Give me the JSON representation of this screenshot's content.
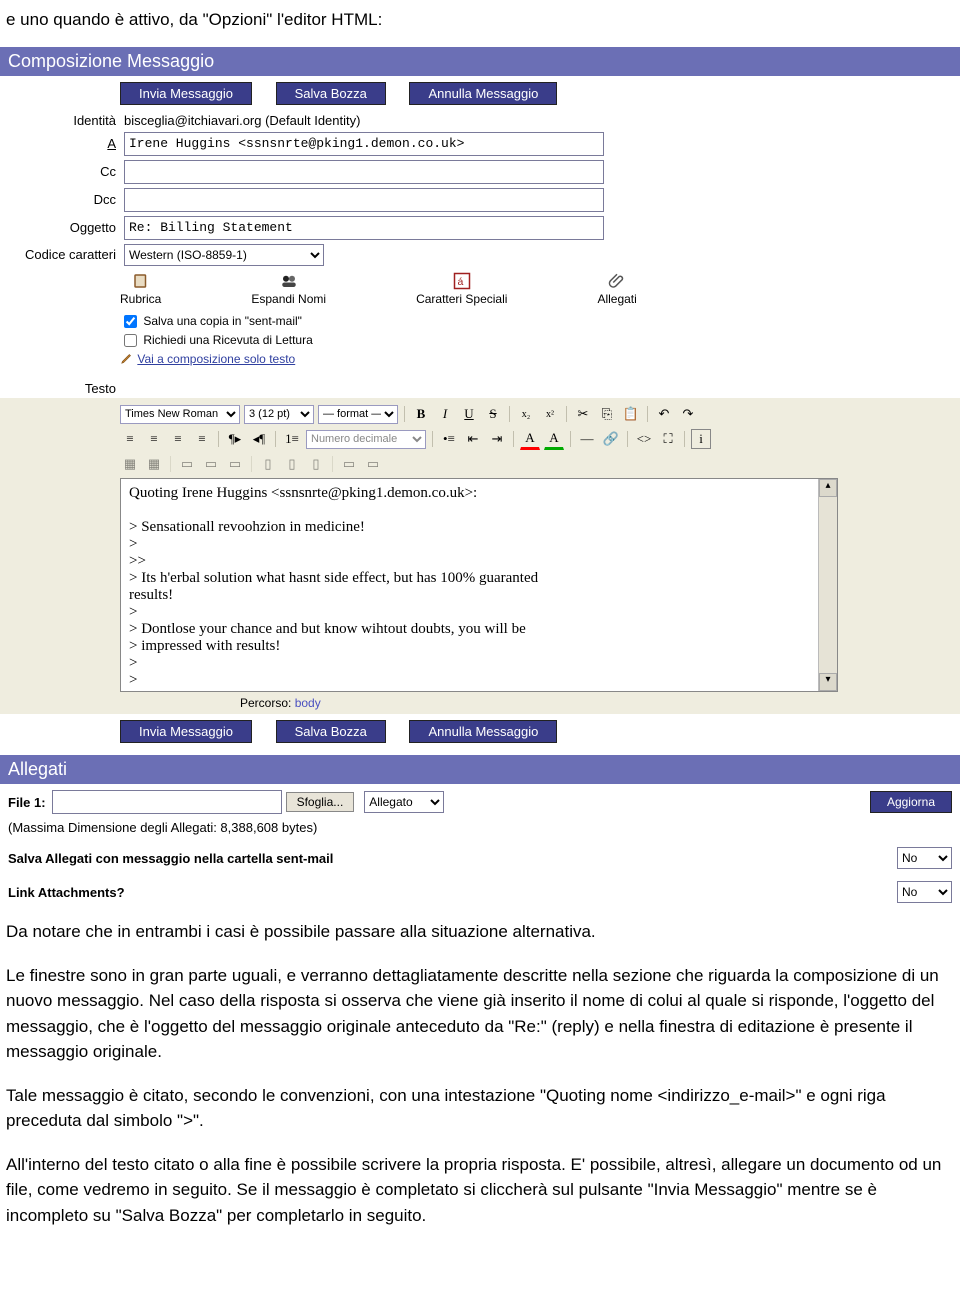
{
  "intro": "e uno quando è attivo, da \"Opzioni\" l'editor HTML:",
  "header_compose": "Composizione Messaggio",
  "buttons": {
    "send": "Invia Messaggio",
    "draft": "Salva Bozza",
    "cancel": "Annulla Messaggio"
  },
  "labels": {
    "identity": "Identità",
    "to": "A",
    "cc": "Cc",
    "bcc": "Dcc",
    "subject": "Oggetto",
    "charset": "Codice caratteri",
    "text": "Testo",
    "path": "Percorso:"
  },
  "fields": {
    "identity": "bisceglia@itchiavari.org (Default Identity)",
    "to": "Irene Huggins <ssnsnrte@pking1.demon.co.uk>",
    "cc": "",
    "bcc": "",
    "subject": "Re: Billing Statement",
    "charset": "Western (ISO-8859-1)"
  },
  "tools": {
    "rubrica": "Rubrica",
    "espandi": "Espandi Nomi",
    "caratteri": "Caratteri Speciali",
    "allegati": "Allegati"
  },
  "options": {
    "save_sent": "Salva una copia in \"sent-mail\"",
    "receipt": "Richiedi una Ricevuta di Lettura",
    "plain": "Vai a composizione solo testo"
  },
  "editor": {
    "font": "Times New Roman",
    "size": "3 (12 pt)",
    "format": "— format —",
    "listfmt": "Numero decimale",
    "body_lines": [
      "Quoting Irene Huggins <ssnsnrte@pking1.demon.co.uk>:",
      "",
      "> Sensationall revoohzion in medicine!",
      ">",
      ">>",
      "> Its h'erbal solution what hasnt side effect, but has 100% guaranted",
      "results!",
      ">",
      "> Dontlose your chance and but know wihtout doubts, you will be",
      "> impressed with results!",
      ">",
      ">"
    ],
    "path_value": "body"
  },
  "attachments": {
    "header": "Allegati",
    "file_label": "File 1:",
    "file_value": "",
    "browse": "Sfoglia...",
    "type": "Allegato",
    "maxsize": "(Massima Dimensione degli Allegati: 8,388,608 bytes)",
    "refresh": "Aggiorna",
    "save_with_msg": "Salva Allegati con messaggio nella cartella sent-mail",
    "link_att": "Link Attachments?",
    "no": "No"
  },
  "paragraphs": {
    "p1": "Da notare che in entrambi i casi è possibile passare alla situazione alternativa.",
    "p2": "Le finestre sono in gran parte uguali, e verranno dettagliatamente descritte nella sezione che riguarda la composizione di un nuovo messaggio. Nel caso della risposta si osserva che viene già inserito il nome di colui al quale si risponde, l'oggetto del messaggio, che è l'oggetto del messaggio originale anteceduto da \"Re:\" (reply) e nella finestra di editazione è presente il messaggio originale.",
    "p3": "Tale messaggio è citato, secondo le convenzioni, con una intestazione \"Quoting nome <indirizzo_e-mail>\" e ogni riga preceduta dal simbolo \">\".",
    "p4": "All'interno del testo citato o alla fine è possibile scrivere la propria risposta. E' possibile, altresì, allegare un documento od un file, come vedremo in seguito. Se il messaggio è completato si cliccherà sul pulsante \"Invia Messaggio\" mentre se è incompleto su \"Salva Bozza\" per completarlo in seguito."
  }
}
